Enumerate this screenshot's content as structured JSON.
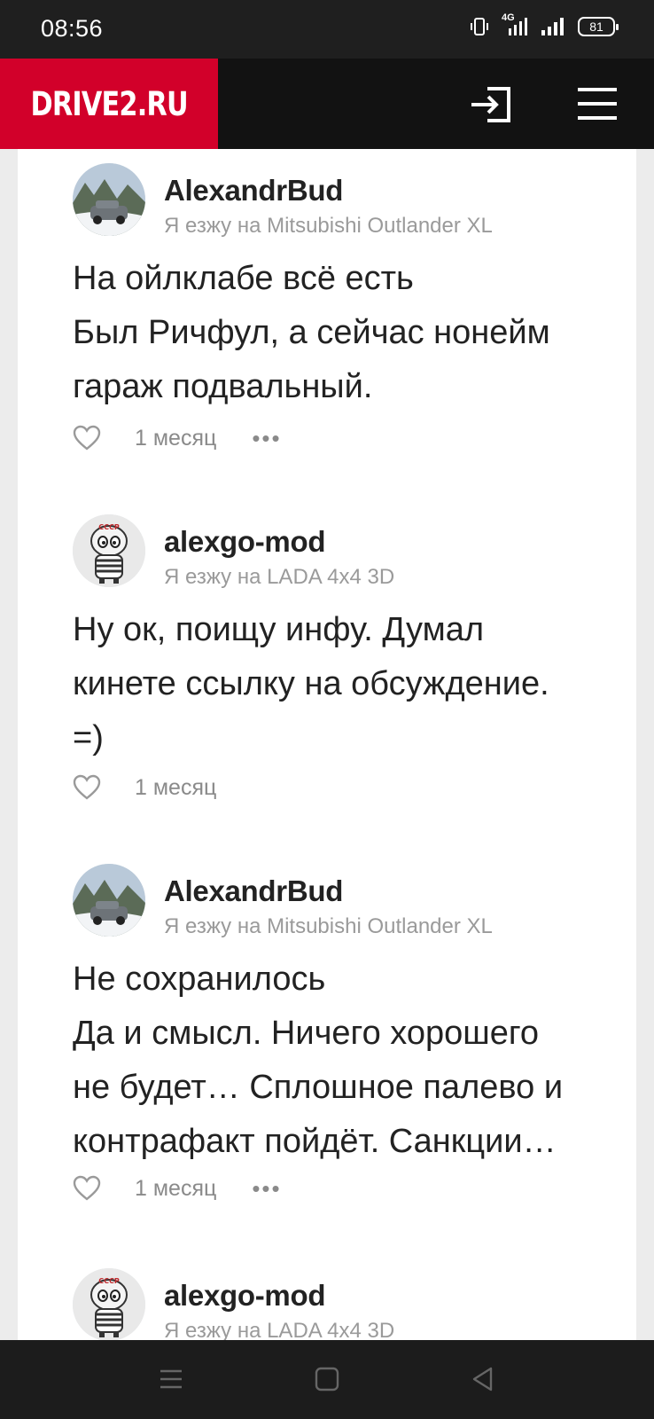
{
  "status_bar": {
    "time": "08:56",
    "network": "4G",
    "battery": "81"
  },
  "header": {
    "logo": "DRIVE2.RU",
    "login_icon": "login-icon",
    "menu_icon": "hamburger-menu-icon",
    "brand_color": "#d2002a"
  },
  "comments": [
    {
      "author": "AlexandrBud",
      "car": "Я езжу на Mitsubishi Outlander XL",
      "lines": [
        "На ойлклабе всё есть",
        "Был Ричфул, а сейчас нонейм",
        "гараж подвальный."
      ],
      "time": "1 месяц",
      "has_more": true
    },
    {
      "author": "alexgo-mod",
      "car": "Я езжу на LADA 4x4 3D",
      "lines": [
        "Ну ок, поищу инфу. Думал",
        "кинете ссылку на обсуждение.",
        "=)"
      ],
      "time": "1 месяц",
      "has_more": false
    },
    {
      "author": "AlexandrBud",
      "car": "Я езжу на Mitsubishi Outlander XL",
      "lines": [
        "Не сохранилось",
        "Да и смысл. Ничего хорошего",
        "не будет… Сплошное палево и",
        "контрафакт пойдёт. Санкции…"
      ],
      "time": "1 месяц",
      "has_more": true
    },
    {
      "author": "alexgo-mod",
      "car": "Я езжу на LADA 4x4 3D"
    }
  ],
  "nav": {
    "recent": "recent-apps-icon",
    "home": "home-icon",
    "back": "back-icon"
  }
}
